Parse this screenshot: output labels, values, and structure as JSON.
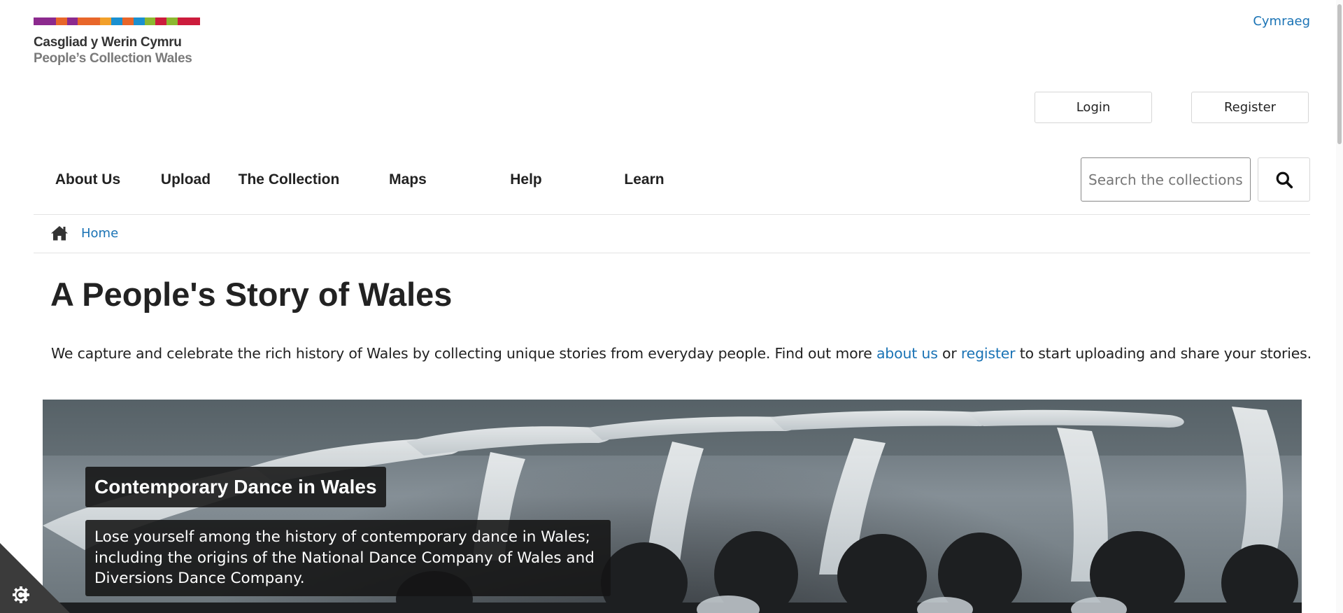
{
  "logo": {
    "line1": "Casgliad y Werin Cymru",
    "line2": "People’s Collection Wales",
    "stripe_colors": [
      "#8c2a8e",
      "#8c2a8e",
      "#e8662a",
      "#8c2a8e",
      "#e8662a",
      "#e8662a",
      "#f2a02a",
      "#1a90d0",
      "#e8662a",
      "#1a90d0",
      "#8cb830",
      "#cc1c3c",
      "#8cb830",
      "#cc1c3c",
      "#cc1c3c"
    ]
  },
  "header": {
    "language_link": "Cymraeg",
    "login_label": "Login",
    "register_label": "Register"
  },
  "nav": {
    "items": [
      {
        "label": "About Us"
      },
      {
        "label": "Upload"
      },
      {
        "label": "The Collection"
      },
      {
        "label": "Maps"
      },
      {
        "label": "Help"
      },
      {
        "label": "Learn"
      }
    ]
  },
  "search": {
    "placeholder": "Search the collections",
    "value": "",
    "button_icon": "search-icon"
  },
  "breadcrumb": {
    "home_icon": "home-icon",
    "home_label": "Home"
  },
  "main": {
    "title": "A People's Story of Wales",
    "intro_before": "We capture and celebrate the rich history of Wales by collecting unique stories from everyday people. Find out more ",
    "intro_link1": "about us",
    "intro_middle": " or ",
    "intro_link2": "register",
    "intro_after": " to start uploading and share your stories."
  },
  "hero": {
    "title": "Contemporary Dance in Wales",
    "description": "Lose yourself among the history of contemporary dance in Wales; including the origins of the National Dance Company of Wales and Diversions Dance Company."
  },
  "cookie": {
    "icon": "cookie-settings-icon"
  },
  "colors": {
    "link": "#1a73b5",
    "text": "#222222",
    "overlay": "#141414"
  }
}
